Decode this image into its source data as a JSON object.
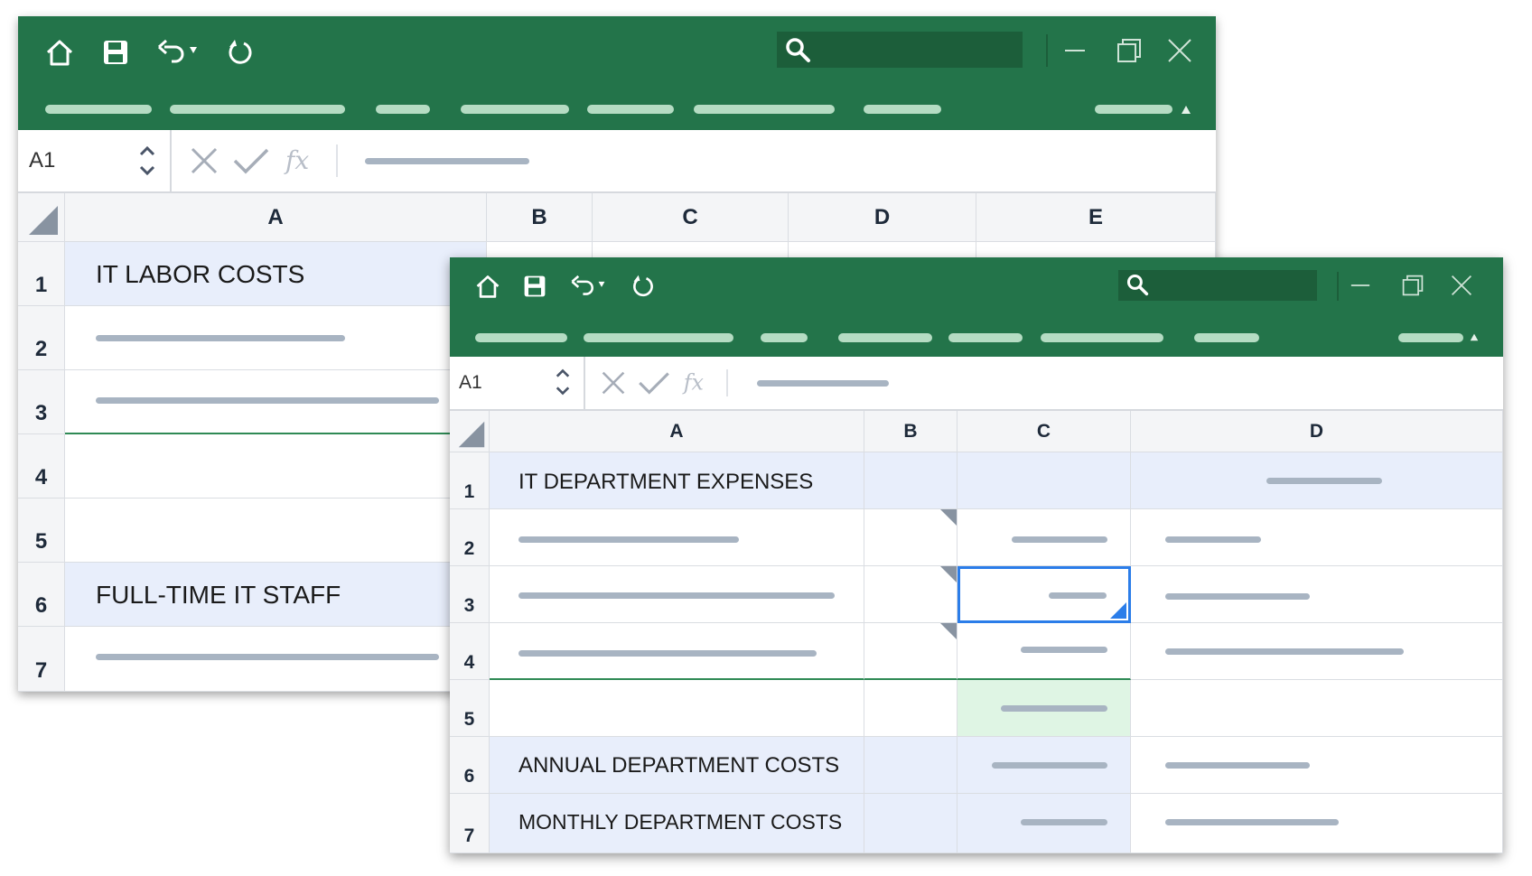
{
  "back_window": {
    "name_box": "A1",
    "columns": [
      "A",
      "B",
      "C",
      "D",
      "E"
    ],
    "rows": [
      "1",
      "2",
      "3",
      "4",
      "5",
      "6",
      "7"
    ],
    "cells": {
      "a1": "IT LABOR COSTS",
      "a6": "FULL-TIME IT STAFF"
    }
  },
  "front_window": {
    "name_box": "A1",
    "columns": [
      "A",
      "B",
      "C",
      "D"
    ],
    "rows": [
      "1",
      "2",
      "3",
      "4",
      "5",
      "6",
      "7"
    ],
    "cells": {
      "a1": "IT DEPARTMENT EXPENSES",
      "a6": "ANNUAL DEPARTMENT COSTS",
      "a7": "MONTHLY DEPARTMENT COSTS"
    }
  },
  "icons": [
    "home-icon",
    "save-icon",
    "undo-icon",
    "redo-icon",
    "search-icon",
    "minimize-icon",
    "restore-icon",
    "close-icon",
    "cancel-x-icon",
    "check-icon",
    "fx-icon",
    "select-all-icon",
    "collapse-ribbon-icon",
    "spinner-icon"
  ],
  "colors": {
    "titlebar": "#23744a",
    "search": "#1c5e3a",
    "ribbon_placeholder": "#b5dcc3",
    "header_bg": "#f4f5f7",
    "row_highlight": "#e8eefb",
    "selection": "#2b7de9",
    "sum_cell": "#dff5e4",
    "placeholder": "#a8b4c2"
  }
}
